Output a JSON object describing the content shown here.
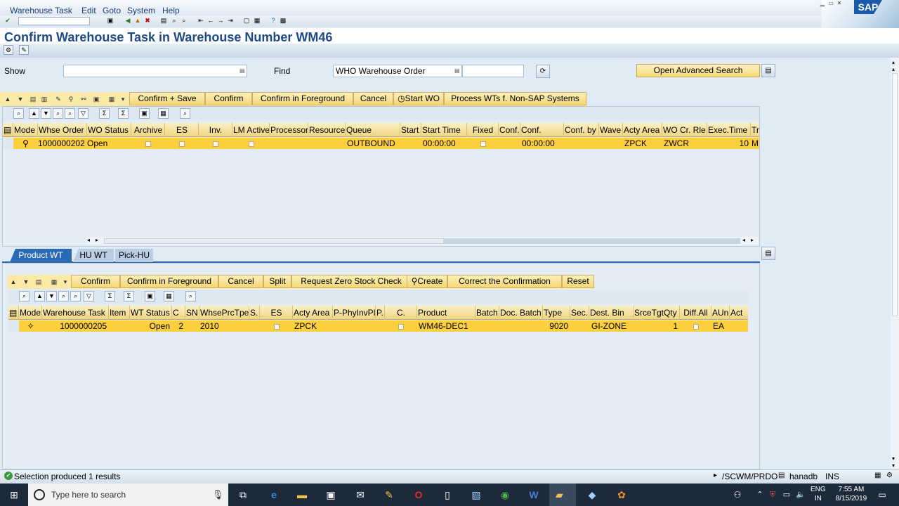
{
  "menu": [
    "Warehouse Task",
    "Edit",
    "Goto",
    "System",
    "Help"
  ],
  "sap_logo": "SAP",
  "title": "Confirm Warehouse Task in Warehouse Number WM46",
  "show": {
    "label": "Show",
    "value": ""
  },
  "find": {
    "label": "Find",
    "value": "WHO Warehouse Order",
    "value2": ""
  },
  "advanced_search_label": "Open Advanced Search",
  "top_actions": [
    "Confirm + Save",
    "Confirm",
    "Confirm in Foreground",
    "Cancel",
    "Start WO",
    "Process WTs f. Non-SAP Systems"
  ],
  "top_grid": {
    "headers": [
      "Mode",
      "Whse Order",
      "WO Status",
      "Archive",
      "ES",
      "Inv.",
      "LM Active",
      "Processor",
      "Resource",
      "Queue",
      "Start",
      "Start Time",
      "Fixed",
      "Conf.",
      "Conf.",
      "Conf. by",
      "Wave",
      "Acty Area",
      "WO Cr. Rle",
      "Exec.Time",
      "Tr"
    ],
    "row": {
      "whse_order": "1000000202",
      "wo_status": "Open",
      "queue": "OUTBOUND",
      "start_time": "00:00:00",
      "conf_time": "00:00:00",
      "acty_area": "ZPCK",
      "wo_cr_rle": "ZWCR",
      "exec_time": "10",
      "tr": "M"
    }
  },
  "tabs": [
    "Product WT",
    "HU WT",
    "Pick-HU"
  ],
  "bottom_actions": [
    "Confirm",
    "Confirm in Foreground",
    "Cancel",
    "Split",
    "Request Zero Stock Check",
    "Create",
    "Correct the Confirmation",
    "Reset"
  ],
  "bottom_grid": {
    "headers": [
      "Mode",
      "Warehouse Task",
      "Item",
      "WT Status",
      "C",
      "SN",
      "WhsePrcTpe",
      "S.",
      "ES",
      "Acty Area",
      "P-PhyInvPl",
      "P.",
      "C.",
      "Product",
      "Batch",
      "Doc. Batch",
      "Type",
      "Sec.",
      "Dest. Bin",
      "SrceTgtQty",
      "Diff.All",
      "AUn",
      "Act"
    ],
    "row": {
      "warehouse_task": "1000000205",
      "wt_status": "Open",
      "c": "2",
      "whse_prc_tpe": "2010",
      "acty_area": "ZPCK",
      "product": "WM46-DEC1",
      "type": "9020",
      "dest_bin": "GI-ZONE",
      "srce_tgt_qty": "1",
      "aun": "EA"
    }
  },
  "status": {
    "message": "Selection produced 1 results",
    "system": "/SCWM/PRDO",
    "server": "hanadb",
    "mode": "INS"
  },
  "taskbar": {
    "search_placeholder": "Type here to search",
    "lang": "ENG",
    "region": "IN",
    "time": "7:55 AM",
    "date": "8/15/2019"
  }
}
